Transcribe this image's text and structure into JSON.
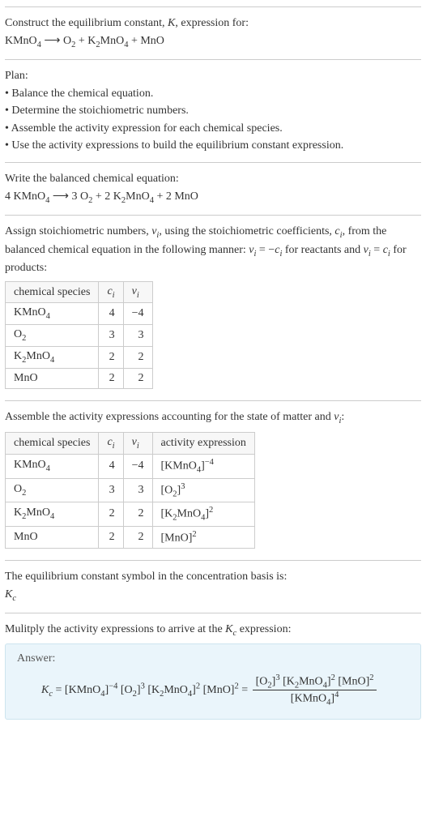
{
  "intro": {
    "title_a": "Construct the equilibrium constant, ",
    "title_b": ", expression for:",
    "K": "K",
    "equation_left": "KMnO",
    "arrow": " ⟶ ",
    "equation_right_a": "O",
    "equation_right_b": " + K",
    "equation_right_c": "MnO",
    "equation_right_d": " + MnO",
    "sub4": "4",
    "sub2": "2"
  },
  "plan": {
    "header": "Plan:",
    "items": [
      "• Balance the chemical equation.",
      "• Determine the stoichiometric numbers.",
      "• Assemble the activity expression for each chemical species.",
      "• Use the activity expressions to build the equilibrium constant expression."
    ]
  },
  "balanced": {
    "header": "Write the balanced chemical equation:",
    "c1": "4 KMnO",
    "c2": " ⟶ 3 O",
    "c3": " + 2 K",
    "c4": "MnO",
    "c5": " + 2 MnO",
    "sub4": "4",
    "sub2": "2"
  },
  "assign": {
    "text_a": "Assign stoichiometric numbers, ",
    "nu_i": "ν",
    "text_b": ", using the stoichiometric coefficients, ",
    "c_i": "c",
    "text_c": ", from the balanced chemical equation in the following manner: ",
    "rel_a": " = −",
    "text_d": " for reactants and ",
    "rel_b": " = ",
    "text_e": " for products:",
    "sub_i": "i"
  },
  "table1": {
    "head": {
      "species": "chemical species",
      "c": "c",
      "nu": "ν",
      "sub_i": "i"
    },
    "rows": [
      {
        "sp_a": "KMnO",
        "sp_sub": "4",
        "c": "4",
        "nu": "−4"
      },
      {
        "sp_a": "O",
        "sp_sub": "2",
        "c": "3",
        "nu": "3"
      },
      {
        "sp_a": "K",
        "sp_sub": "2",
        "sp_b": "MnO",
        "sp_sub2": "4",
        "c": "2",
        "nu": "2"
      },
      {
        "sp_a": "MnO",
        "sp_sub": "",
        "c": "2",
        "nu": "2"
      }
    ]
  },
  "assemble": {
    "text_a": "Assemble the activity expressions accounting for the state of matter and ",
    "nu": "ν",
    "sub_i": "i",
    "text_b": ":"
  },
  "table2": {
    "head": {
      "species": "chemical species",
      "c": "c",
      "nu": "ν",
      "ae": "activity expression",
      "sub_i": "i"
    },
    "rows": [
      {
        "sp_a": "KMnO",
        "sp_sub": "4",
        "c": "4",
        "nu": "−4",
        "ae_a": "[KMnO",
        "ae_sub": "4",
        "ae_b": "]",
        "ae_exp": "−4"
      },
      {
        "sp_a": "O",
        "sp_sub": "2",
        "c": "3",
        "nu": "3",
        "ae_a": "[O",
        "ae_sub": "2",
        "ae_b": "]",
        "ae_exp": "3"
      },
      {
        "sp_a": "K",
        "sp_sub": "2",
        "sp_b": "MnO",
        "sp_sub2": "4",
        "c": "2",
        "nu": "2",
        "ae_a": "[K",
        "ae_sub": "2",
        "ae_b": "MnO",
        "ae_sub2": "4",
        "ae_c": "]",
        "ae_exp": "2"
      },
      {
        "sp_a": "MnO",
        "sp_sub": "",
        "c": "2",
        "nu": "2",
        "ae_a": "[MnO]",
        "ae_exp": "2"
      }
    ]
  },
  "symbol": {
    "text": "The equilibrium constant symbol in the concentration basis is:",
    "K": "K",
    "sub_c": "c"
  },
  "mult": {
    "text_a": "Mulitply the activity expressions to arrive at the ",
    "K": "K",
    "sub_c": "c",
    "text_b": " expression:"
  },
  "answer": {
    "label": "Answer:",
    "K": "K",
    "sub_c": "c",
    "eq": " = ",
    "t1_a": "[KMnO",
    "t1_sub": "4",
    "t1_b": "]",
    "t1_exp": "−4",
    "t2_a": " [O",
    "t2_sub": "2",
    "t2_b": "]",
    "t2_exp": "3",
    "t3_a": " [K",
    "t3_sub": "2",
    "t3_b": "MnO",
    "t3_sub2": "4",
    "t3_c": "]",
    "t3_exp": "2",
    "t4_a": " [MnO]",
    "t4_exp": "2",
    "eq2": " = ",
    "num_a": "[O",
    "num_sub1": "2",
    "num_b": "]",
    "num_exp1": "3",
    "num_c": " [K",
    "num_sub2": "2",
    "num_d": "MnO",
    "num_sub3": "4",
    "num_e": "]",
    "num_exp2": "2",
    "num_f": " [MnO]",
    "num_exp3": "2",
    "den_a": "[KMnO",
    "den_sub": "4",
    "den_b": "]",
    "den_exp": "4"
  }
}
